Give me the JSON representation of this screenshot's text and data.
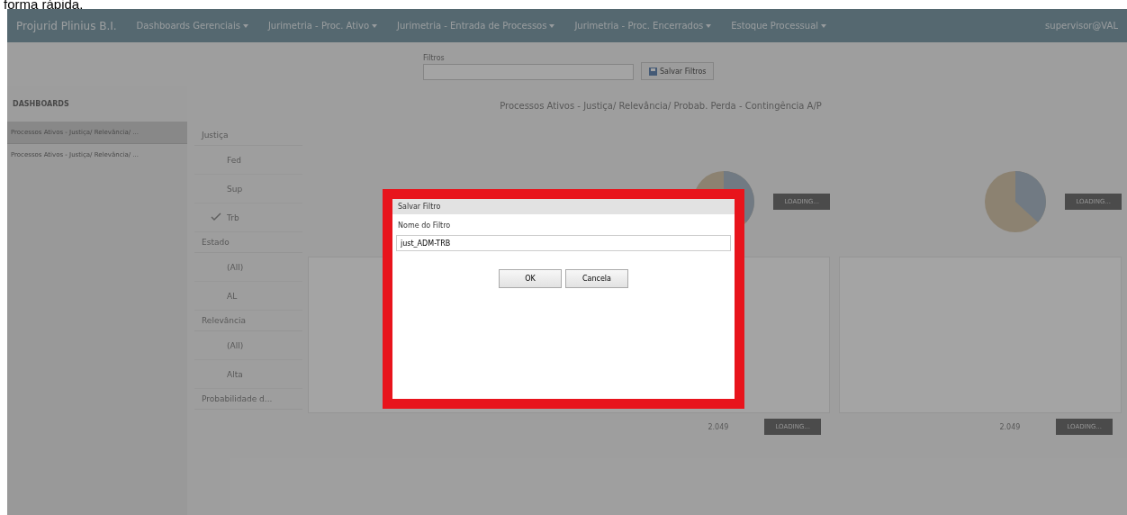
{
  "caption": "forma rápida.",
  "nav": {
    "brand": "Projurid Plinius B.I.",
    "menus": [
      {
        "label": "Dashboards Gerenciais"
      },
      {
        "label": "Jurimetria - Proc. Ativo"
      },
      {
        "label": "Jurimetria - Entrada de Processos"
      },
      {
        "label": "Jurimetria - Proc. Encerrados"
      },
      {
        "label": "Estoque Processual"
      }
    ],
    "user": "supervisor@VAL"
  },
  "filter_bar": {
    "label": "Filtros",
    "save_button": "Salvar Filtros"
  },
  "sidebar": {
    "heading": "DASHBOARDS",
    "items": [
      {
        "label": "Processos Ativos - Justiça/ Relevância/ ...",
        "selected": true
      },
      {
        "label": "Processos Ativos - Justiça/ Relevância/ ...",
        "selected": false
      }
    ]
  },
  "report_title": "Processos Ativos - Justiça/ Relevância/ Probab. Perda - Contingência A/P",
  "slicers": [
    {
      "title": "Justiça",
      "items": [
        {
          "label": "Fed",
          "checked": false
        },
        {
          "label": "Sup",
          "checked": false
        },
        {
          "label": "Trb",
          "checked": true
        }
      ]
    },
    {
      "title": "Estado",
      "items": [
        {
          "label": "(All)",
          "checked": false
        },
        {
          "label": "AL",
          "checked": false
        }
      ]
    },
    {
      "title": "Relevância",
      "items": [
        {
          "label": "(All)",
          "checked": false
        },
        {
          "label": "Alta",
          "checked": false
        }
      ]
    },
    {
      "title": "Probabilidade d..."
    }
  ],
  "panels": [
    {
      "loading": "LOADING...",
      "total": "2.049",
      "total_loading": "LOADING..."
    },
    {
      "loading": "LOADING...",
      "total": "2.049",
      "total_loading": "LOADING..."
    }
  ],
  "dialog": {
    "title": "Salvar Filtro",
    "field_label": "Nome do Filtro",
    "field_value": "just_ADM-TRB",
    "buttons": [
      "OK",
      "Cancela"
    ]
  }
}
